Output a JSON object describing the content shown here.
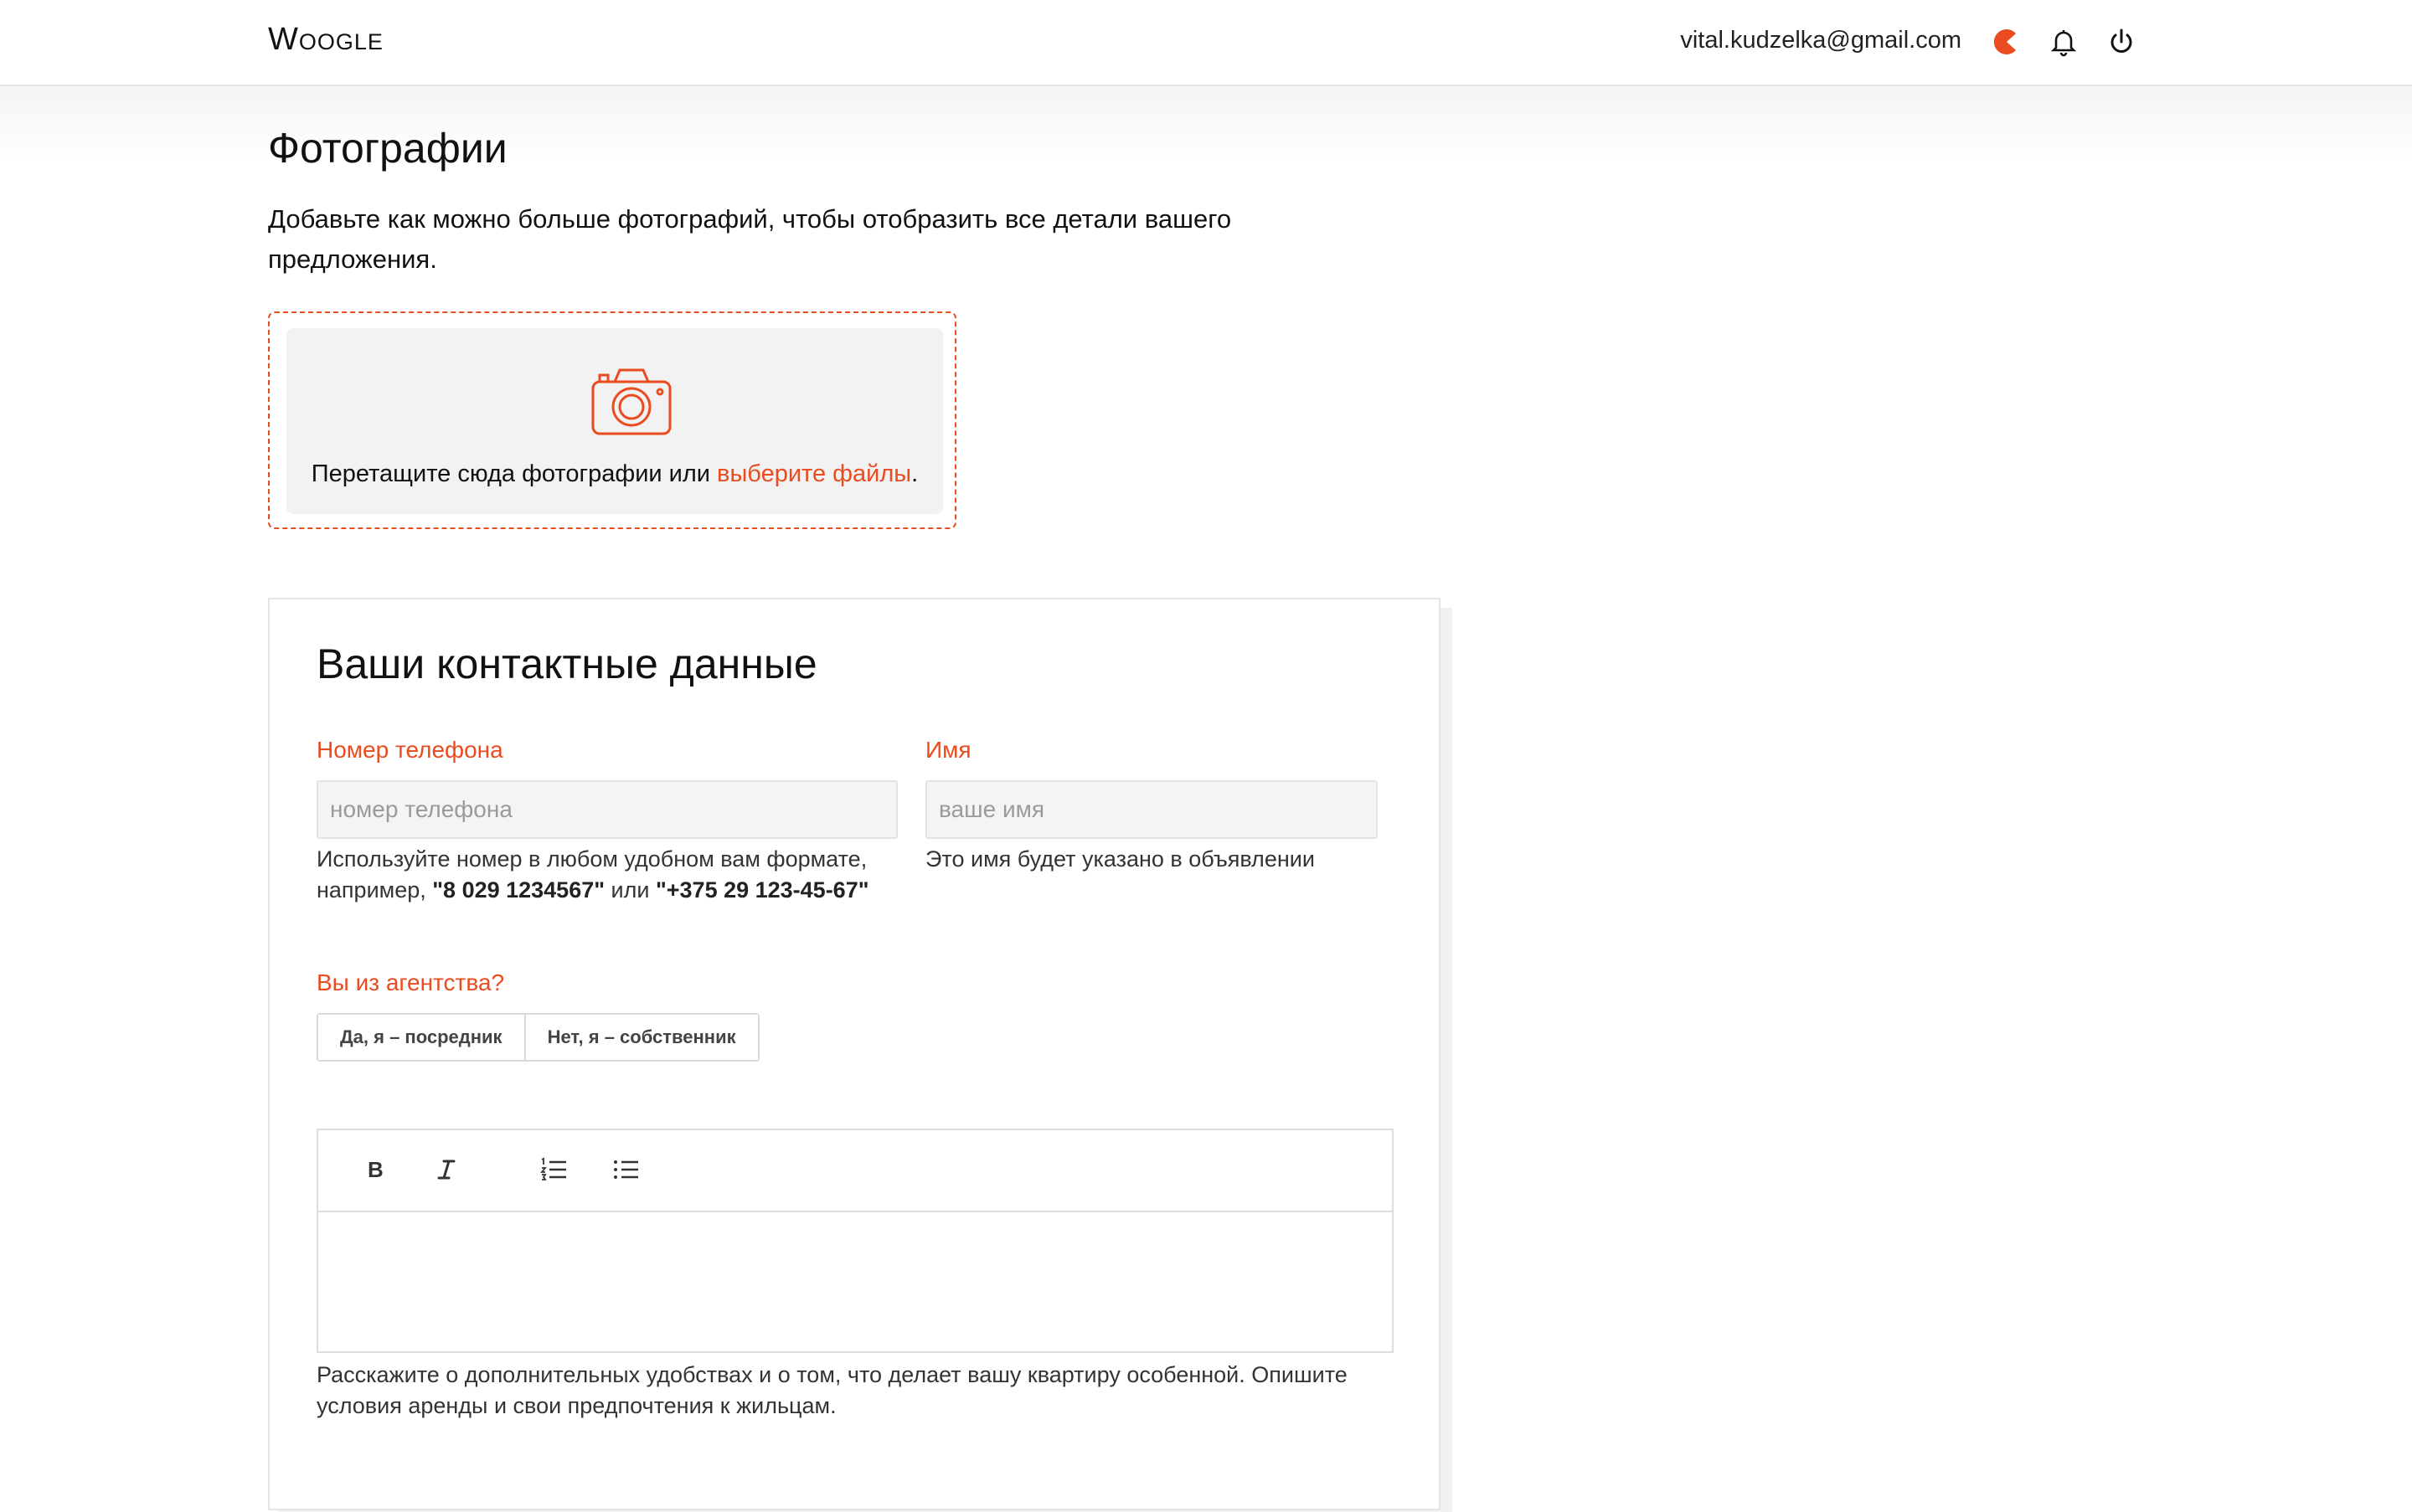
{
  "header": {
    "logo": "Woogle",
    "email": "vital.kudzelka@gmail.com",
    "icons": [
      "pacman-icon",
      "bell-icon",
      "power-icon"
    ],
    "accent_color": "#ea4b1f"
  },
  "photos": {
    "title": "Фотографии",
    "description": "Добавьте как можно больше фотографий, чтобы отобразить все детали вашего предложения.",
    "drop_text": "Перетащите сюда фотографии или ",
    "drop_link": "выберите файлы",
    "drop_end": "."
  },
  "contact": {
    "title": "Ваши контактные данные",
    "phone": {
      "label": "Номер телефона",
      "placeholder": "номер телефона",
      "value": "",
      "hint_prefix": "Используйте номер в любом удобном вам формате, например, ",
      "example1": "\"8 029 1234567\"",
      "hint_or": " или ",
      "example2": "\"+375 29 123-45-67\""
    },
    "name": {
      "label": "Имя",
      "placeholder": "ваше имя",
      "value": "",
      "hint": "Это имя будет указано в объявлении"
    },
    "agency": {
      "label": "Вы из агентства?",
      "options": [
        "Да, я – посредник",
        "Нет, я – собственник"
      ]
    },
    "editor": {
      "toolbar": [
        "bold-icon",
        "italic-icon",
        "numbered-list-icon",
        "bullet-list-icon"
      ],
      "content": "",
      "hint": "Расскажите о дополнительных удобствах и о том, что делает вашу квартиру особенной. Опишите условия аренды и свои предпочтения к жильцам."
    }
  }
}
